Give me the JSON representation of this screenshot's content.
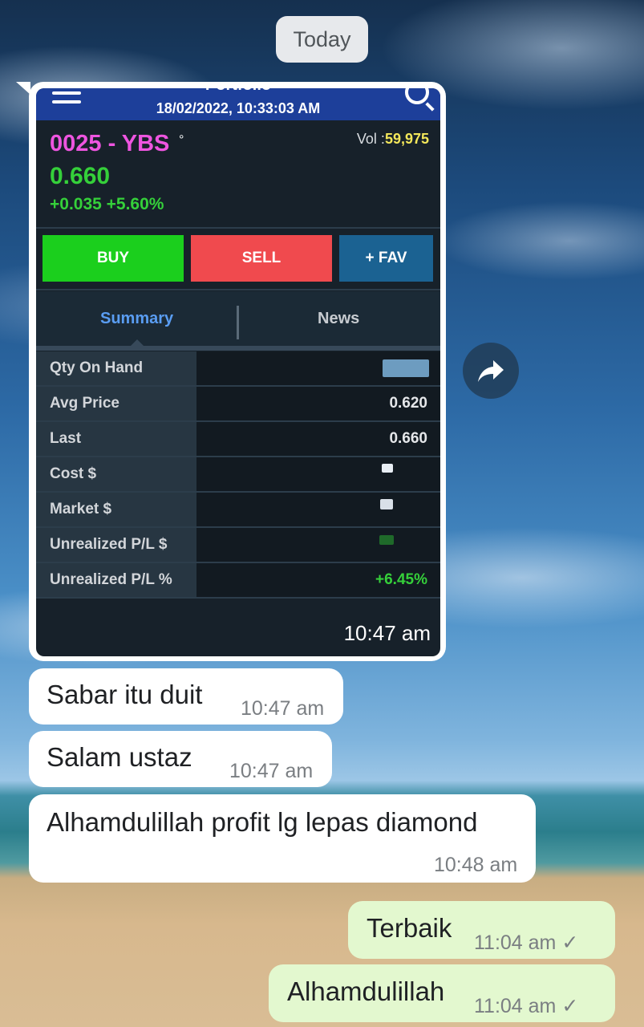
{
  "date_chip": "Today",
  "shared_image": {
    "app_title": "Portfolio",
    "datetime": "18/02/2022, 10:33:03 AM",
    "ticker": "0025 - YBS",
    "ticker_marker": "°",
    "volume_label": "Vol :",
    "volume_value": "59,975",
    "price": "0.660",
    "change": "+0.035 +5.60%",
    "buttons": {
      "buy": "BUY",
      "sell": "SELL",
      "fav": "+ FAV"
    },
    "tabs": {
      "summary": "Summary",
      "news": "News",
      "active": "Summary"
    },
    "rows": [
      {
        "label": "Qty On Hand",
        "value": ""
      },
      {
        "label": "Avg Price",
        "value": "0.620"
      },
      {
        "label": "Last",
        "value": "0.660"
      },
      {
        "label": "Cost $",
        "value": ""
      },
      {
        "label": "Market $",
        "value": ""
      },
      {
        "label": "Unrealized P/L $",
        "value": ""
      },
      {
        "label": "Unrealized P/L %",
        "value": "+6.45%"
      }
    ],
    "timestamp": "10:47 am"
  },
  "messages": [
    {
      "direction": "incoming",
      "text": "Sabar itu duit",
      "time": "10:47 am"
    },
    {
      "direction": "incoming",
      "text": "Salam ustaz",
      "time": "10:47 am"
    },
    {
      "direction": "incoming",
      "text": "Alhamdulillah profit lg lepas diamond",
      "time": "10:48 am"
    },
    {
      "direction": "outgoing",
      "text": "Terbaik",
      "time": "11:04 am",
      "status": "✓"
    },
    {
      "direction": "outgoing",
      "text": "Alhamdulillah",
      "time": "11:04 am",
      "status": "✓"
    }
  ],
  "colors": {
    "ticker": "#ee55e0",
    "positive": "#35d03a",
    "buy": "#1bcf1d",
    "sell": "#f04a4e",
    "fav": "#1b6292",
    "outgoing_bubble": "#e3f8cf"
  },
  "icons": {
    "menu": "hamburger-icon",
    "search": "search-icon",
    "share": "forward-arrow-icon",
    "read": "check-icon"
  }
}
